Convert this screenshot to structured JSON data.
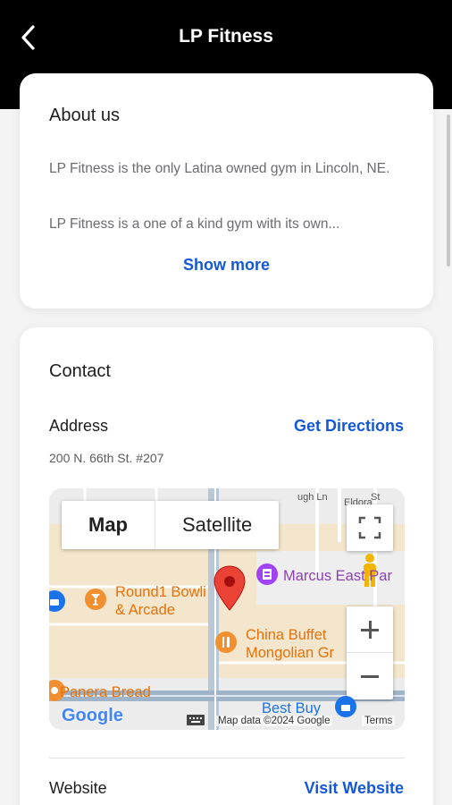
{
  "header": {
    "title": "LP Fitness"
  },
  "about": {
    "heading": "About us",
    "line1": "LP Fitness is the only Latina owned gym in Lincoln, NE.",
    "line2": "LP Fitness is a one of a kind gym with its own...",
    "show_more": "Show more"
  },
  "contact": {
    "heading": "Contact",
    "address_label": "Address",
    "directions_label": "Get Directions",
    "address_value": "200 N. 66th St. #207",
    "website_label": "Website",
    "visit_label": "Visit Website"
  },
  "map": {
    "toggle_map": "Map",
    "toggle_satellite": "Satellite",
    "places": {
      "round1_line1": "Round1 Bowli",
      "round1_line2": "& Arcade",
      "china_line1": "China Buffet",
      "china_line2": "Mongolian Gr",
      "marcus": "Marcus East Par",
      "panera": "Panera Bread",
      "bestbuy": "Best Buy"
    },
    "streets": {
      "s1": "ugh Ln",
      "s2": "Eldora",
      "s3": "St"
    },
    "logo": "Google",
    "attribution": "Map data ©2024 Google",
    "terms": "Terms",
    "colors": {
      "accent": "#1558d6",
      "pin": "#ea4335",
      "label_orange": "#e8710a",
      "label_purple": "#8e3fb5",
      "label_blue": "#1a73e8"
    }
  }
}
